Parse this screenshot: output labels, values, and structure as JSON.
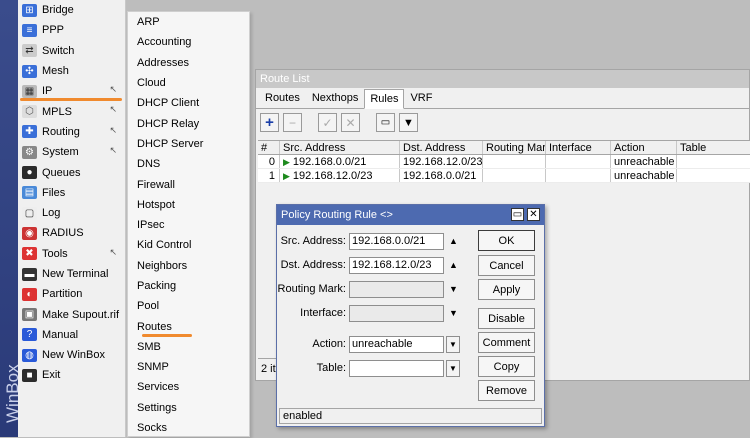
{
  "app": {
    "brand": "WinBox"
  },
  "main_menu": [
    {
      "label": "Bridge",
      "icon": "bridge-icon",
      "arrow": false
    },
    {
      "label": "PPP",
      "icon": "ppp-icon",
      "arrow": false
    },
    {
      "label": "Switch",
      "icon": "switch-icon",
      "arrow": false
    },
    {
      "label": "Mesh",
      "icon": "mesh-icon",
      "arrow": false
    },
    {
      "label": "IP",
      "icon": "ip-icon",
      "arrow": true
    },
    {
      "label": "MPLS",
      "icon": "mpls-icon",
      "arrow": true
    },
    {
      "label": "Routing",
      "icon": "routing-icon",
      "arrow": true
    },
    {
      "label": "System",
      "icon": "system-icon",
      "arrow": true
    },
    {
      "label": "Queues",
      "icon": "queues-icon",
      "arrow": false
    },
    {
      "label": "Files",
      "icon": "files-icon",
      "arrow": false
    },
    {
      "label": "Log",
      "icon": "log-icon",
      "arrow": false
    },
    {
      "label": "RADIUS",
      "icon": "radius-icon",
      "arrow": false
    },
    {
      "label": "Tools",
      "icon": "tools-icon",
      "arrow": true
    },
    {
      "label": "New Terminal",
      "icon": "terminal-icon",
      "arrow": false
    },
    {
      "label": "Partition",
      "icon": "partition-icon",
      "arrow": false
    },
    {
      "label": "Make Supout.rif",
      "icon": "supout-icon",
      "arrow": false
    },
    {
      "label": "Manual",
      "icon": "manual-icon",
      "arrow": false
    },
    {
      "label": "New WinBox",
      "icon": "winbox-icon",
      "arrow": false
    },
    {
      "label": "Exit",
      "icon": "exit-icon",
      "arrow": false
    }
  ],
  "ip_submenu": [
    "ARP",
    "Accounting",
    "Addresses",
    "Cloud",
    "DHCP Client",
    "DHCP Relay",
    "DHCP Server",
    "DNS",
    "Firewall",
    "Hotspot",
    "IPsec",
    "Kid Control",
    "Neighbors",
    "Packing",
    "Pool",
    "Routes",
    "SMB",
    "SNMP",
    "Services",
    "Settings",
    "Socks"
  ],
  "route_list": {
    "title": "Route List",
    "tabs": [
      "Routes",
      "Nexthops",
      "Rules",
      "VRF"
    ],
    "active_tab": "Rules",
    "columns": [
      "#",
      "Src. Address",
      "Dst. Address",
      "Routing Mark",
      "Interface",
      "Action",
      "Table"
    ],
    "rows": [
      {
        "num": "0",
        "src": "192.168.0.0/21",
        "dst": "192.168.12.0/23",
        "mark": "",
        "iface": "",
        "action": "unreachable",
        "table": ""
      },
      {
        "num": "1",
        "src": "192.168.12.0/23",
        "dst": "192.168.0.0/21",
        "mark": "",
        "iface": "",
        "action": "unreachable",
        "table": ""
      }
    ],
    "status": "2 it"
  },
  "dialog": {
    "title": "Policy Routing Rule <>",
    "src_label": "Src. Address:",
    "src_value": "192.168.0.0/21",
    "dst_label": "Dst. Address:",
    "dst_value": "192.168.12.0/23",
    "mark_label": "Routing Mark:",
    "mark_value": "",
    "iface_label": "Interface:",
    "iface_value": "",
    "action_label": "Action:",
    "action_value": "unreachable",
    "table_label": "Table:",
    "table_value": "",
    "buttons": {
      "ok": "OK",
      "cancel": "Cancel",
      "apply": "Apply",
      "disable": "Disable",
      "comment": "Comment",
      "copy": "Copy",
      "remove": "Remove"
    },
    "status": "enabled"
  },
  "colors": {
    "accent_underline": "#f08a2e",
    "dialog_title": "#4d6ab0",
    "winbox_strip": "#2f4080"
  }
}
